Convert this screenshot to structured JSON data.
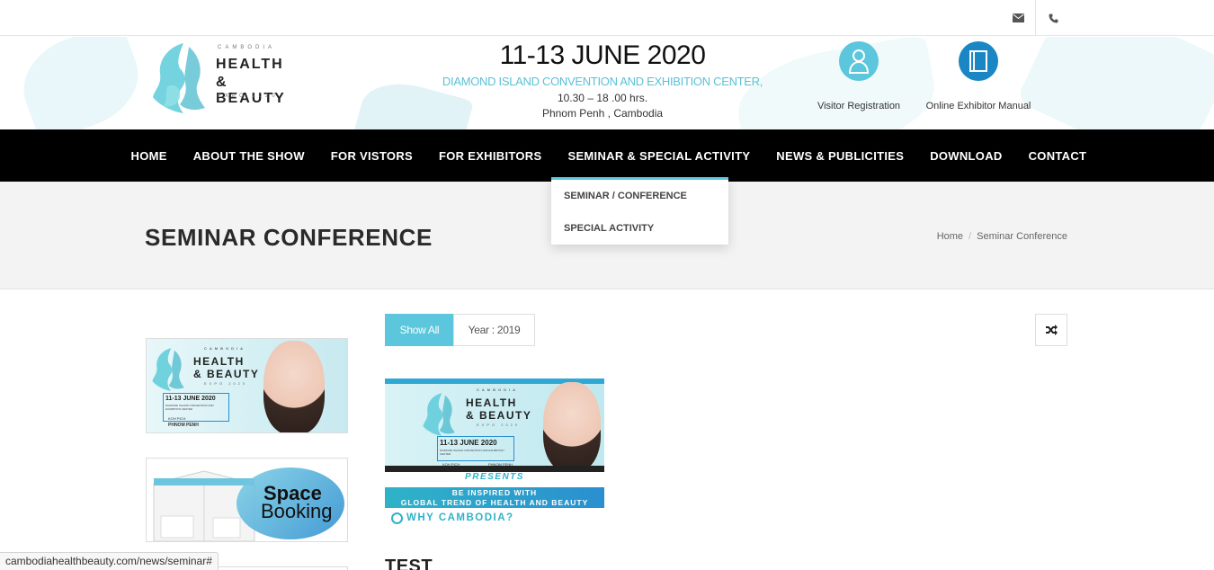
{
  "topbar": {
    "mail_icon": "envelope-icon",
    "phone_icon": "phone-icon"
  },
  "header": {
    "logo": {
      "line1": "CAMBODIA",
      "line2": "HEALTH",
      "line3": "& BEAUTY",
      "line4": "EXPO 2020"
    },
    "event": {
      "date": "11-13 JUNE 2020",
      "venue": "DIAMOND ISLAND CONVENTION AND EXHIBITION CENTER,",
      "time": "10.30 – 18 .00 hrs.",
      "city": "Phnom Penh , Cambodia"
    },
    "visitor_label": "Visitor Registration",
    "exhibitor_label": "Online Exhibitor Manual"
  },
  "nav": {
    "items": [
      {
        "label": "HOME"
      },
      {
        "label": "ABOUT THE SHOW"
      },
      {
        "label": "FOR VISTORS"
      },
      {
        "label": "FOR EXHIBITORS"
      },
      {
        "label": "SEMINAR & SPECIAL ACTIVITY"
      },
      {
        "label": "NEWS & PUBLICITIES"
      },
      {
        "label": "DOWNLOAD"
      },
      {
        "label": "CONTACT"
      }
    ],
    "dropdown": [
      {
        "label": "SEMINAR / CONFERENCE"
      },
      {
        "label": "SPECIAL ACTIVITY"
      }
    ]
  },
  "page": {
    "title": "SEMINAR CONFERENCE",
    "breadcrumb_home": "Home",
    "breadcrumb_sep": "/",
    "breadcrumb_current": "Seminar Conference"
  },
  "sidebar": {
    "banner1": {
      "line1": "CAMBODIA",
      "line2": "HEALTH",
      "line3": "& BEAUTY",
      "line4": "EXPO 2020",
      "date": "11-13 JUNE 2020",
      "venue": "DIAMOND ISLAND CONVENTION AND EXHIBITION CENTER",
      "loc1": "KOH PICH",
      "loc2": "PHNOM PENH"
    },
    "banner2": {
      "line1": "Space",
      "line2": "Booking"
    }
  },
  "filters": {
    "show_all": "Show All",
    "year": "Year : 2019",
    "shuffle_icon": "shuffle-icon"
  },
  "post": {
    "img": {
      "line1": "CAMBODIA",
      "line2": "HEALTH",
      "line3": "& BEAUTY",
      "line4": "EXPO 2020",
      "date": "11-13 JUNE 2020",
      "venue": "DIAMOND ISLAND CONVENTION AND EXHIBITION CENTER",
      "loc1": "KOH PICH",
      "loc2": "PHNOM PENH",
      "presents": "PRESENTS",
      "inspire1": "BE INSPIRED WITH",
      "inspire2": "GLOBAL TREND OF HEALTH AND BEAUTY",
      "why": "WHY CAMBODIA?"
    },
    "title": "TEST"
  },
  "statusbar": {
    "url": "cambodiahealthbeauty.com/news/seminar#"
  },
  "colors": {
    "accent": "#5bc6dc",
    "accent_dark": "#1a86c4",
    "nav_bg": "#000000"
  }
}
